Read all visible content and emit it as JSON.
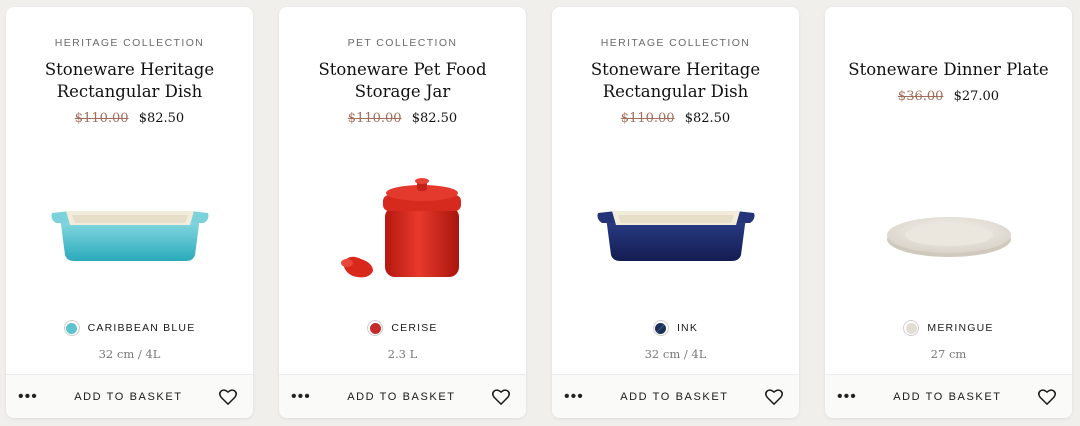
{
  "products": [
    {
      "collection": "HERITAGE COLLECTION",
      "title": "Stoneware Heritage Rectangular Dish",
      "price_old": "$110.00",
      "price_new": "$82.50",
      "colour_name": "CARIBBEAN BLUE",
      "colour_hex": "#5bc4cc",
      "size": "32 cm / 4L",
      "basket_label": "ADD TO BASKET",
      "more_label": "•••",
      "image": "rectangular-dish-caribbean"
    },
    {
      "collection": "PET COLLECTION",
      "title": "Stoneware Pet Food Storage Jar",
      "price_old": "$110.00",
      "price_new": "$82.50",
      "colour_name": "CERISE",
      "colour_hex": "#c62b2b",
      "size": "2.3 L",
      "basket_label": "ADD TO BASKET",
      "more_label": "•••",
      "image": "pet-storage-jar-cerise"
    },
    {
      "collection": "HERITAGE COLLECTION",
      "title": "Stoneware Heritage Rectangular Dish",
      "price_old": "$110.00",
      "price_new": "$82.50",
      "colour_name": "INK",
      "colour_hex": "#1d2f56",
      "size": "32 cm / 4L",
      "basket_label": "ADD TO BASKET",
      "more_label": "•••",
      "image": "rectangular-dish-ink"
    },
    {
      "collection": "",
      "title": "Stoneware Dinner Plate",
      "price_old": "$36.00",
      "price_new": "$27.00",
      "colour_name": "MERINGUE",
      "colour_hex": "#e2ddd5",
      "size": "27 cm",
      "basket_label": "ADD TO BASKET",
      "more_label": "•••",
      "image": "dinner-plate-meringue"
    }
  ],
  "colors": {
    "page_background": "#f0efec",
    "card_background": "#ffffff",
    "old_price": "#a26e5c"
  }
}
